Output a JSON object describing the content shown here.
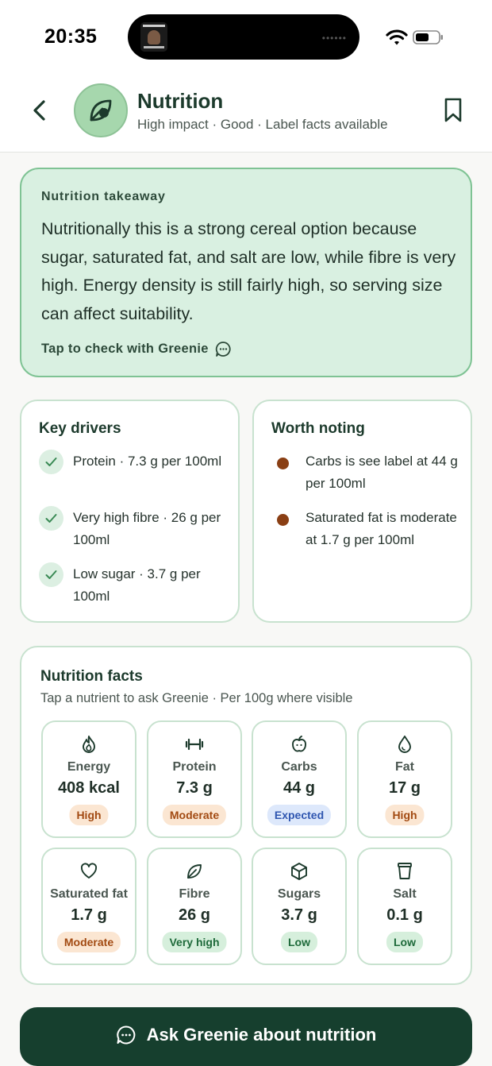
{
  "status_bar": {
    "time": "20:35",
    "island_thumb_line1": "PIETER SMITH",
    "island_thumb_line2": "STUDENTS"
  },
  "header": {
    "back_icon": "chevron-left-icon",
    "avatar_icon": "leaf-icon",
    "title": "Nutrition",
    "subtitle": "High impact · Good · Label facts available",
    "bookmark_icon": "bookmark-icon"
  },
  "takeaway": {
    "label": "Nutrition takeaway",
    "text": "Nutritionally this is a strong cereal option because sugar, saturated fat, and salt are low, while fibre is very high. Energy density is still fairly high, so serving size can affect suitability.",
    "cta": "Tap to check with Greenie",
    "cta_icon": "chat-bubble-icon"
  },
  "key_drivers": {
    "title": "Key drivers",
    "items": [
      {
        "text": "Protein · 7.3 g per 100ml"
      },
      {
        "text": "Very high fibre · 26 g per 100ml"
      },
      {
        "text": "Low sugar · 3.7 g per 100ml"
      }
    ]
  },
  "worth_noting": {
    "title": "Worth noting",
    "items": [
      {
        "text": "Carbs is see label at 44 g per 100ml"
      },
      {
        "text": "Saturated fat is moderate at 1.7 g per 100ml"
      }
    ]
  },
  "nutrition_facts": {
    "title": "Nutrition facts",
    "subtitle": "Tap a nutrient to ask Greenie · Per 100g where visible",
    "tiles": [
      {
        "icon": "flame-icon",
        "label": "Energy",
        "value": "408 kcal",
        "badge": "High",
        "badge_bg": "#fbe6d2",
        "badge_fg": "#a24a12"
      },
      {
        "icon": "dumbbell-icon",
        "label": "Protein",
        "value": "7.3 g",
        "badge": "Moderate",
        "badge_bg": "#fbe6d2",
        "badge_fg": "#a24a12"
      },
      {
        "icon": "apple-icon",
        "label": "Carbs",
        "value": "44 g",
        "badge": "Expected",
        "badge_bg": "#dde8fb",
        "badge_fg": "#2f56b0"
      },
      {
        "icon": "droplet-icon",
        "label": "Fat",
        "value": "17 g",
        "badge": "High",
        "badge_bg": "#fbe6d2",
        "badge_fg": "#a24a12"
      },
      {
        "icon": "heart-icon",
        "label": "Saturated fat",
        "value": "1.7 g",
        "badge": "Moderate",
        "badge_bg": "#fbe6d2",
        "badge_fg": "#a24a12"
      },
      {
        "icon": "leaf-icon",
        "label": "Fibre",
        "value": "26 g",
        "badge": "Very high",
        "badge_bg": "#d6efdc",
        "badge_fg": "#1e6a3a"
      },
      {
        "icon": "cube-icon",
        "label": "Sugars",
        "value": "3.7 g",
        "badge": "Low",
        "badge_bg": "#d6efdc",
        "badge_fg": "#1e6a3a"
      },
      {
        "icon": "cup-icon",
        "label": "Salt",
        "value": "0.1 g",
        "badge": "Low",
        "badge_bg": "#d6efdc",
        "badge_fg": "#1e6a3a"
      }
    ]
  },
  "ask_button": {
    "label": "Ask Greenie about nutrition",
    "icon": "chat-bubble-icon"
  },
  "colors": {
    "primary_dark": "#163f2e",
    "takeaway_bg": "#d9f0e1",
    "accent_green": "#7fc394",
    "note_dot": "#8a3f14"
  }
}
